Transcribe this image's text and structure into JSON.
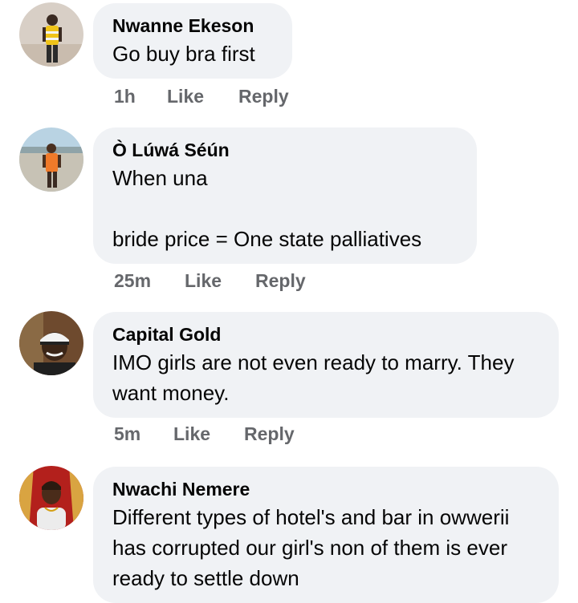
{
  "comments": [
    {
      "author": "Nwanne Ekeson",
      "text": "Go buy bra first",
      "time": "1h",
      "like_label": "Like",
      "reply_label": "Reply",
      "avatar_icon": "profile-photo-man-yellow-vest"
    },
    {
      "author": "Ò Lúwá Séún",
      "text": "When una\n\nbride price = One state palliatives",
      "time": "25m",
      "like_label": "Like",
      "reply_label": "Reply",
      "avatar_icon": "profile-photo-man-orange-shirt"
    },
    {
      "author": "Capital Gold",
      "text": "IMO girls are not even ready to marry. They want money.",
      "time": "5m",
      "like_label": "Like",
      "reply_label": "Reply",
      "avatar_icon": "profile-photo-man-cap"
    },
    {
      "author": "Nwachi Nemere",
      "text": "Different types of hotel's and bar in owwerii has corrupted our girl's non of them is ever ready to settle down",
      "avatar_icon": "profile-photo-man-red-background"
    }
  ],
  "colors": {
    "bubble": "#f0f2f5",
    "action_text": "#65676b",
    "text": "#050505"
  }
}
